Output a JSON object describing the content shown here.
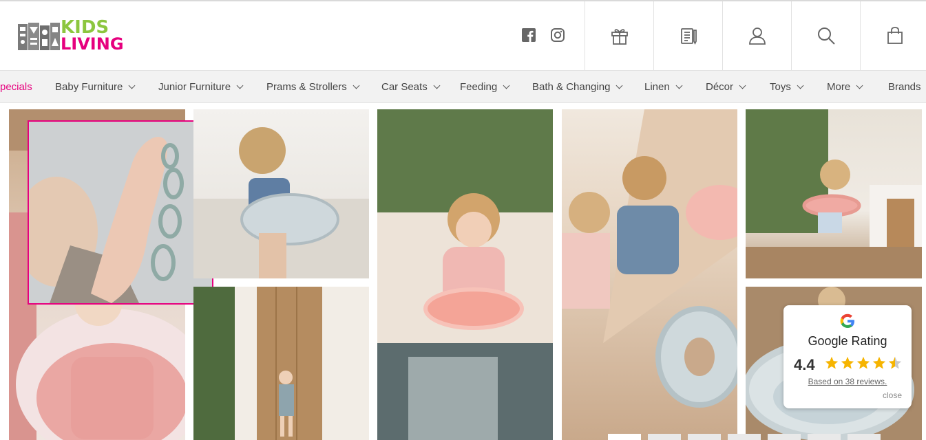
{
  "brand": {
    "line1": "KIDS",
    "line2": "LIVING",
    "green": "#8cc63f",
    "pink": "#e6007e"
  },
  "social": [
    {
      "name": "facebook-icon"
    },
    {
      "name": "instagram-icon"
    }
  ],
  "header_icons": [
    {
      "name": "gift-icon"
    },
    {
      "name": "registry-list-icon"
    },
    {
      "name": "account-icon"
    },
    {
      "name": "search-icon"
    },
    {
      "name": "cart-icon"
    }
  ],
  "nav": {
    "items": [
      {
        "label": "pecials",
        "dropdown": false
      },
      {
        "label": "Baby Furniture",
        "dropdown": true
      },
      {
        "label": "Junior Furniture",
        "dropdown": true
      },
      {
        "label": "Prams & Strollers",
        "dropdown": true
      },
      {
        "label": "Car Seats",
        "dropdown": true
      },
      {
        "label": "Feeding",
        "dropdown": true
      },
      {
        "label": "Bath & Changing",
        "dropdown": true
      },
      {
        "label": "Linen",
        "dropdown": true
      },
      {
        "label": "Décor",
        "dropdown": true
      },
      {
        "label": "Toys",
        "dropdown": true
      },
      {
        "label": "More",
        "dropdown": true
      },
      {
        "label": "Brands",
        "dropdown": false
      }
    ]
  },
  "rating": {
    "title": "Google Rating",
    "score": "4.4",
    "stars": 4.4,
    "reviews": "Based on 38 reviews.",
    "close": "close"
  },
  "slider": {
    "count": 7,
    "active": 1
  }
}
